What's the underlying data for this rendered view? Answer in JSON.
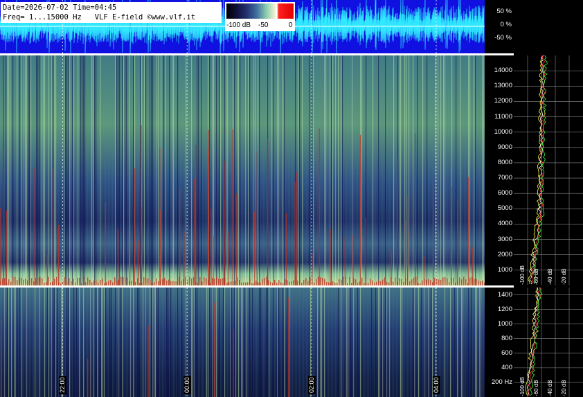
{
  "header": {
    "date_time": "Date=2026-07-02 Time=04:45",
    "freq_info": "Freq= 1...15000 Hz   VLF E-field ©www.vlf.it"
  },
  "colorbar": {
    "ticks": [
      "-100 dB",
      "-50",
      "0"
    ]
  },
  "chart_data": [
    {
      "type": "line",
      "title": "",
      "ylabel": "",
      "yticks": [
        "50 %",
        "0 %",
        "-50 %"
      ],
      "ylim": [
        -80,
        80
      ]
    },
    {
      "type": "heatmap",
      "title": "",
      "y_unit": "Hz",
      "ylim": [
        0,
        15000
      ],
      "yticks": [
        1000,
        2000,
        3000,
        4000,
        5000,
        6000,
        7000,
        8000,
        9000,
        10000,
        11000,
        12000,
        13000,
        14000
      ],
      "ytick_labels": [
        "1000",
        "2000",
        "3000",
        "4000",
        "5000",
        "6000",
        "7000",
        "8000",
        "9000",
        "10000",
        "11000",
        "12000",
        "13000",
        "14000"
      ],
      "x_time_labels": [
        "22:00",
        "00:00",
        "02:00",
        "04:00"
      ],
      "colorscale_db": [
        -100,
        0
      ]
    },
    {
      "type": "heatmap",
      "title": "",
      "y_unit": "Hz",
      "ylim": [
        0,
        1500
      ],
      "yticks": [
        200,
        400,
        600,
        800,
        1000,
        1200,
        1400
      ],
      "ytick_labels": [
        "200 Hz",
        "400",
        "600",
        "800",
        "1000",
        "1200",
        "1400"
      ],
      "x_time_labels": [
        "22:00",
        "00:00",
        "02:00",
        "04:00"
      ],
      "colorscale_db": [
        -100,
        0
      ]
    },
    {
      "type": "line",
      "title": "",
      "xlabel": "",
      "x_tick_labels": [
        "-100 dB",
        "-60 dB",
        "-40 dB",
        "-20 dB"
      ],
      "series": [
        {
          "color": "#ffff40"
        },
        {
          "color": "#ffffff"
        },
        {
          "color": "#ff3030"
        },
        {
          "color": "#40ff40"
        }
      ]
    }
  ],
  "colors": {
    "background": "#000000",
    "waveform_bg": "#1010e0",
    "waveform_line": "#30e8ff",
    "spectrum_dark": "#141a4a",
    "spectrum_mid": "#2f6a8f",
    "spectrum_bright": "#8fd08a",
    "impulse_red": "#c03020"
  }
}
